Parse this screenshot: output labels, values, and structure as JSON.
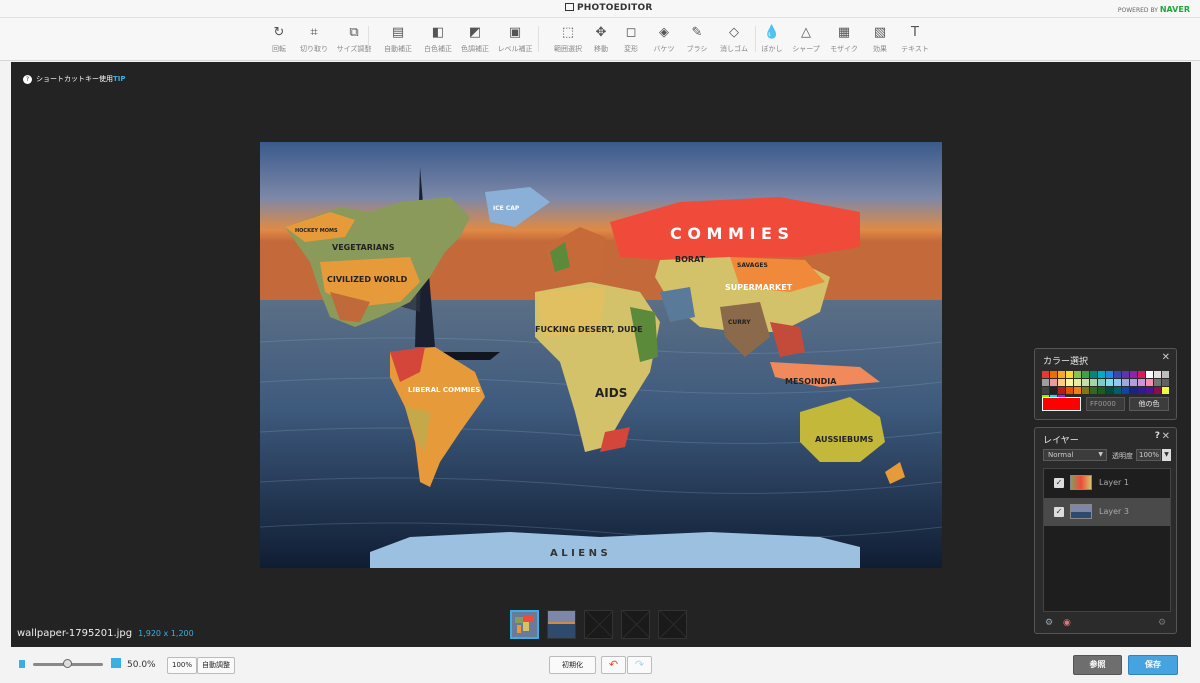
{
  "header": {
    "app_title": "PHOTOEDITOR",
    "powered_prefix": "POWERED BY",
    "powered_brand": "NAVER"
  },
  "toolbar": {
    "tools": [
      {
        "label": "回転",
        "icon": "rotate-icon",
        "glyph": "↻"
      },
      {
        "label": "切り取り",
        "icon": "crop-icon",
        "glyph": "⌗"
      },
      {
        "label": "サイズ調整",
        "icon": "resize-icon",
        "glyph": "⧉"
      },
      {
        "label": "自動補正",
        "icon": "auto-correct-icon",
        "glyph": "▤"
      },
      {
        "label": "白色補正",
        "icon": "white-balance-icon",
        "glyph": "◧"
      },
      {
        "label": "色調補正",
        "icon": "color-correct-icon",
        "glyph": "◩"
      },
      {
        "label": "レベル補正",
        "icon": "level-correct-icon",
        "glyph": "▣"
      },
      {
        "label": "範囲選択",
        "icon": "select-range-icon",
        "glyph": "⬚"
      },
      {
        "label": "移動",
        "icon": "move-icon",
        "glyph": "✥"
      },
      {
        "label": "変形",
        "icon": "transform-icon",
        "glyph": "◻"
      },
      {
        "label": "バケツ",
        "icon": "bucket-icon",
        "glyph": "◈"
      },
      {
        "label": "ブラシ",
        "icon": "brush-icon",
        "glyph": "✎"
      },
      {
        "label": "消しゴム",
        "icon": "eraser-icon",
        "glyph": "◇"
      },
      {
        "label": "ぼかし",
        "icon": "blur-icon",
        "glyph": "💧"
      },
      {
        "label": "シャープ",
        "icon": "sharpen-icon",
        "glyph": "△"
      },
      {
        "label": "モザイク",
        "icon": "mosaic-icon",
        "glyph": "▦"
      },
      {
        "label": "効果",
        "icon": "effects-icon",
        "glyph": "▧"
      },
      {
        "label": "テキスト",
        "icon": "text-icon",
        "glyph": "T"
      }
    ]
  },
  "workspace": {
    "tip_text": "ショートカットキー使用",
    "tip_key": "TIP",
    "filename": "wallpaper-1795201.jpg",
    "dimensions": "1,920 x 1,200"
  },
  "canvas_labels": {
    "commies": "C O M M I E S",
    "vegetarians": "VEGETARIANS",
    "civilized": "CIVILIZED WORLD",
    "hockey": "HOCKEY MOMS",
    "icecap": "ICE CAP",
    "liberal": "LIBERAL COMMIES",
    "desert": "FUCKING DESERT, DUDE",
    "aids": "AIDS",
    "borat": "BORAT",
    "savages": "SAVAGES",
    "supermarket": "SUPERMARKET",
    "curry": "CURRY",
    "mesoindia": "MESOINDIA",
    "aussiebums": "AUSSIEBUMS",
    "aliens": "A L I E N S"
  },
  "color_panel": {
    "title": "カラー選択",
    "current_color": "#ff0000",
    "hex_value": "FF0000",
    "other_color_label": "他の色",
    "swatches": [
      "#e53935",
      "#ef6c00",
      "#f9a825",
      "#fdd835",
      "#8bc34a",
      "#43a047",
      "#00897b",
      "#00acc1",
      "#1e88e5",
      "#3949ab",
      "#5e35b1",
      "#8e24aa",
      "#d81b60",
      "#ffffff",
      "#e0e0e0",
      "#bdbdbd",
      "#9e9e9e",
      "#ef9a9a",
      "#ffcc80",
      "#fff59d",
      "#e6ee9c",
      "#c5e1a5",
      "#a5d6a7",
      "#80cbc4",
      "#80deea",
      "#90caf9",
      "#9fa8da",
      "#b39ddb",
      "#ce93d8",
      "#f48fb1",
      "#757575",
      "#616161",
      "#424242",
      "#212121",
      "#b71c1c",
      "#e65100",
      "#f57f17",
      "#827717",
      "#33691e",
      "#1b5e20",
      "#004d40",
      "#006064",
      "#0d47a1",
      "#1a237e",
      "#311b92",
      "#4a148c",
      "#880e4f",
      "#eeff41",
      "#76ff03",
      "#00e5ff",
      "#d500f9"
    ]
  },
  "layer_panel": {
    "title": "レイヤー",
    "help": "?",
    "blend_mode": "Normal",
    "opacity_label": "透明度",
    "opacity_value": "100%",
    "layers": [
      {
        "name": "Layer 1",
        "checked": true,
        "selected": false
      },
      {
        "name": "Layer 3",
        "checked": true,
        "selected": true
      }
    ]
  },
  "bottom": {
    "zoom_value": "50.0%",
    "zoom_fraction": 0.5,
    "btn_100": "100%",
    "btn_auto": "自動調整",
    "btn_reset": "初期化",
    "btn_browse": "参照",
    "btn_save": "保存"
  }
}
